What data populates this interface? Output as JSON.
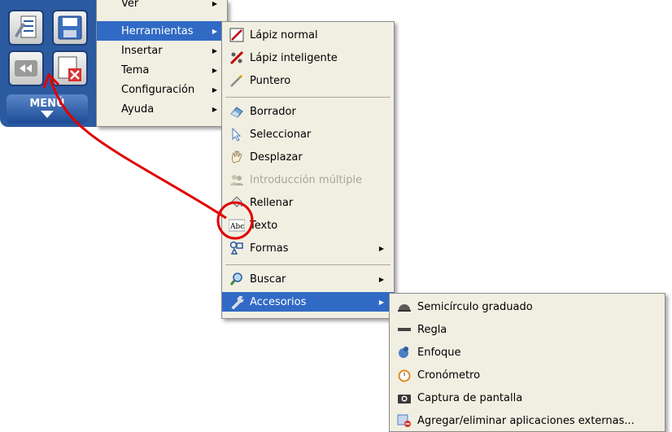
{
  "toolbar": {
    "menu_label": "MENÚ"
  },
  "main_menu": {
    "items": [
      {
        "label": "Ver"
      },
      {
        "label": "Herramientas"
      },
      {
        "label": "Insertar"
      },
      {
        "label": "Tema"
      },
      {
        "label": "Configuración"
      },
      {
        "label": "Ayuda"
      }
    ]
  },
  "tools_menu": {
    "items": [
      {
        "label": "Lápiz normal"
      },
      {
        "label": "Lápiz inteligente"
      },
      {
        "label": "Puntero"
      },
      {
        "label": "Borrador"
      },
      {
        "label": "Seleccionar"
      },
      {
        "label": "Desplazar"
      },
      {
        "label": "Introducción múltiple"
      },
      {
        "label": "Rellenar"
      },
      {
        "label": "Texto"
      },
      {
        "label": "Formas"
      },
      {
        "label": "Buscar"
      },
      {
        "label": "Accesorios"
      }
    ]
  },
  "accessories_menu": {
    "items": [
      {
        "label": "Semicírculo graduado"
      },
      {
        "label": "Regla"
      },
      {
        "label": "Enfoque"
      },
      {
        "label": "Cronómetro"
      },
      {
        "label": "Captura de pantalla"
      },
      {
        "label": "Agregar/eliminar aplicaciones externas..."
      }
    ]
  },
  "colors": {
    "highlight": "#316ac5",
    "menu_bg": "#f1efe2",
    "annotation": "#e00000"
  }
}
